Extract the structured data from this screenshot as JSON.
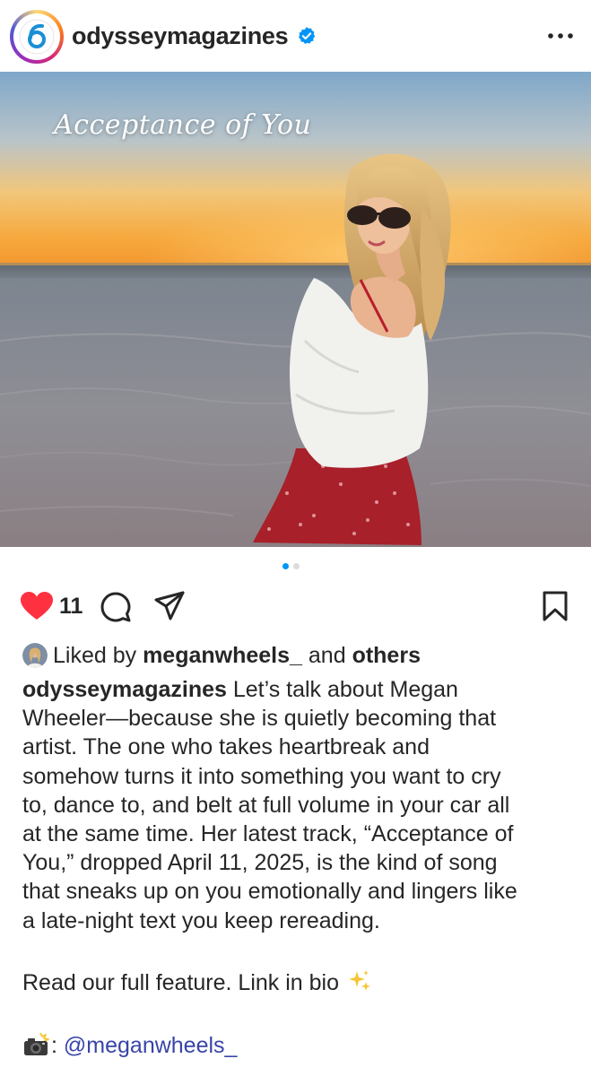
{
  "header": {
    "username": "odysseymagazines",
    "avatar_icon": "odyssey-logo-icon",
    "verified_icon": "verified-badge-icon",
    "more_icon": "more-options-icon"
  },
  "post": {
    "image_title": "Acceptance of You",
    "carousel": {
      "current_index": 1,
      "total": 2
    }
  },
  "actions": {
    "like_icon": "heart-filled-icon",
    "like_count": "11",
    "comment_icon": "comment-icon",
    "share_icon": "share-icon",
    "save_icon": "bookmark-icon"
  },
  "liked_by": {
    "prefix": "Liked by",
    "user": "meganwheels_",
    "connector": "and",
    "others": "others"
  },
  "caption": {
    "username": "odysseymagazines",
    "lines": [
      " Let’s talk about Megan",
      "Wheeler—because she is quietly becoming that",
      "artist. The one who takes heartbreak and",
      "somehow turns it into something you want to cry",
      "to, dance to, and belt at full volume in your car all",
      "at the same time. Her latest track, “Acceptance of",
      "You,” dropped April 11, 2025, is the kind of song",
      "that sneaks up on you emotionally and lingers like",
      "a late-night text you keep rereading."
    ],
    "feature_text": "Read our full feature. Link in bio ",
    "sparkle_icon": "sparkles-icon",
    "credit_icon": "camera-flash-icon",
    "credit_separator": ": ",
    "credit_mention": "@meganwheels_"
  },
  "colors": {
    "text": "#262626",
    "like_red": "#ff3040",
    "verified_blue": "#0095f6",
    "mention_blue": "#3845a8",
    "dot_active": "#0095f6",
    "dot_inactive": "#dbdbdb"
  }
}
